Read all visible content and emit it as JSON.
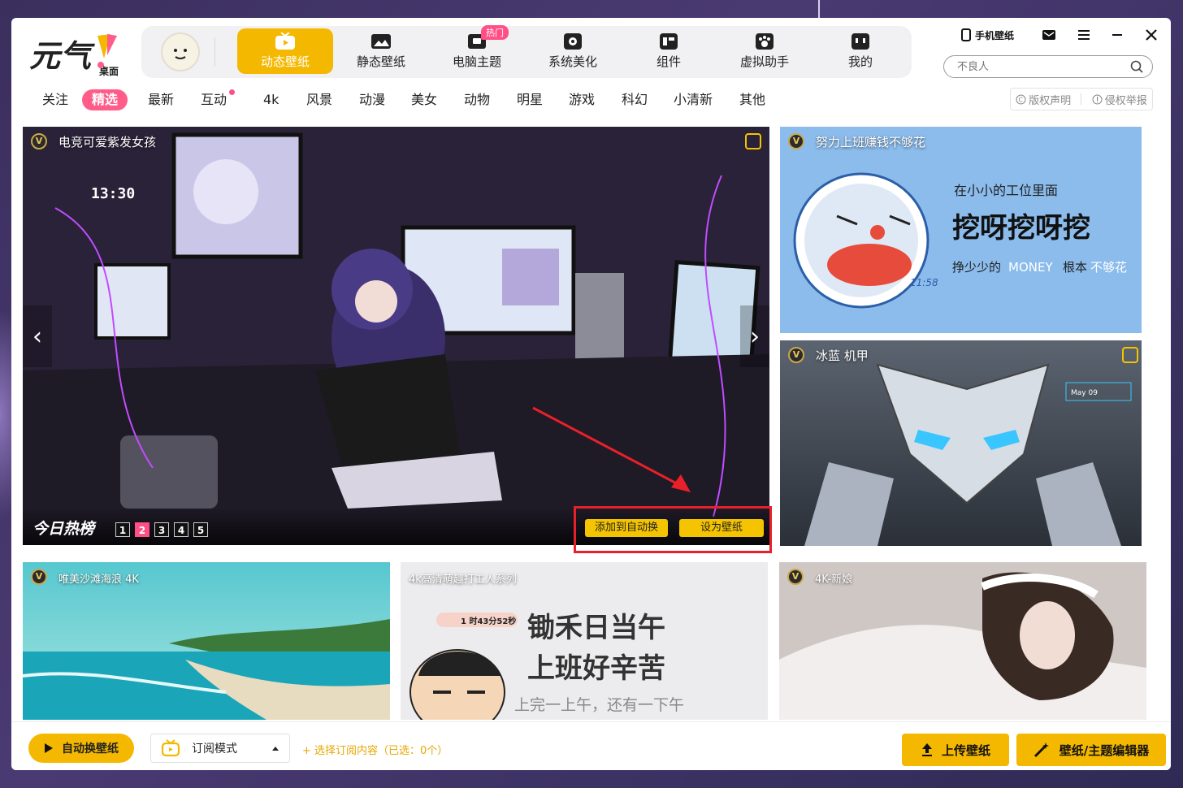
{
  "app": {
    "logo_text": "元气",
    "logo_sub": "桌面"
  },
  "nav": {
    "items": [
      {
        "label": "动态壁纸",
        "icon": "play-tv-icon",
        "active": true
      },
      {
        "label": "静态壁纸",
        "icon": "image-icon"
      },
      {
        "label": "电脑主题",
        "icon": "theme-icon",
        "badge": "热门"
      },
      {
        "label": "系统美化",
        "icon": "flower-icon"
      },
      {
        "label": "组件",
        "icon": "widget-icon"
      },
      {
        "label": "虚拟助手",
        "icon": "paw-icon"
      },
      {
        "label": "我的",
        "icon": "face-icon"
      }
    ]
  },
  "topbar": {
    "phone_wallpaper": "手机壁纸"
  },
  "search": {
    "placeholder": "不良人"
  },
  "categories": [
    {
      "label": "关注"
    },
    {
      "label": "精选",
      "active": true
    },
    {
      "label": "最新"
    },
    {
      "label": "互动",
      "dot": true
    },
    {
      "label": "4k"
    },
    {
      "label": "风景"
    },
    {
      "label": "动漫"
    },
    {
      "label": "美女"
    },
    {
      "label": "动物"
    },
    {
      "label": "明星"
    },
    {
      "label": "游戏"
    },
    {
      "label": "科幻"
    },
    {
      "label": "小清新"
    },
    {
      "label": "其他"
    }
  ],
  "legal": {
    "copyright": "版权声明",
    "report": "侵权举报"
  },
  "hero": {
    "title": "电竞可爱紫发女孩",
    "clock": "13:30",
    "hot_list": "今日热榜",
    "pages": [
      "1",
      "2",
      "3",
      "4",
      "5"
    ],
    "active_page": 2,
    "add_auto": "添加到自动换",
    "set_wallpaper": "设为壁纸"
  },
  "cards": {
    "work": {
      "title": "努力上班赚钱不够花",
      "line1": "在小小的工位里面",
      "line2": "挖呀挖呀挖",
      "line3a": "挣少少的",
      "line3b": "MONEY",
      "line3c": "根本",
      "line3d": "不够花",
      "clock": "11:58"
    },
    "mech": {
      "title": "冰蓝 机甲",
      "hud": "May 09"
    },
    "beach": {
      "title": "唯美沙滩海浪 4K"
    },
    "office": {
      "title": "4k高清萌趣打工人系列",
      "timer": "1 时43分52秒",
      "poem1": "锄禾日当午",
      "poem2": "上班好辛苦",
      "poem3": "上完一上午，还有一下午"
    },
    "bride": {
      "title": "4K-新娘"
    }
  },
  "footer": {
    "auto_change": "自动换壁纸",
    "sub_mode": "订阅模式",
    "select_sub": "+ 选择订阅内容（已选：0个）",
    "upload": "上传壁纸",
    "editor": "壁纸/主题编辑器"
  },
  "colors": {
    "accent": "#f5b800",
    "pink": "#ff5c8a",
    "highlight": "#e8202a"
  }
}
